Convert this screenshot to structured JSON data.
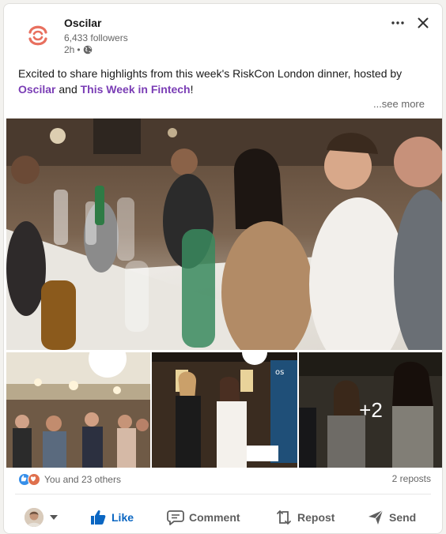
{
  "post": {
    "company": "Oscilar",
    "followers": "6,433 followers",
    "time": "2h",
    "time_separator": "•",
    "text_before": "Excited to share highlights from this week's RiskCon London dinner, hosted by ",
    "mention_1": "Oscilar",
    "text_middle": " and ",
    "mention_2": "This Week in Fintech",
    "text_after": "!",
    "see_more": "...see more"
  },
  "photos": {
    "extra_count": "+2",
    "banner_letter": "os"
  },
  "social": {
    "reactions_text": "You and 23 others",
    "reposts_text": "2 reposts",
    "reaction_icons": [
      "like-icon",
      "love-icon"
    ]
  },
  "actions": {
    "like": "Like",
    "comment": "Comment",
    "repost": "Repost",
    "send": "Send"
  },
  "colors": {
    "brand_logo": "#e8705f",
    "mention": "#7a3db5",
    "like_active": "#0a66c2"
  }
}
